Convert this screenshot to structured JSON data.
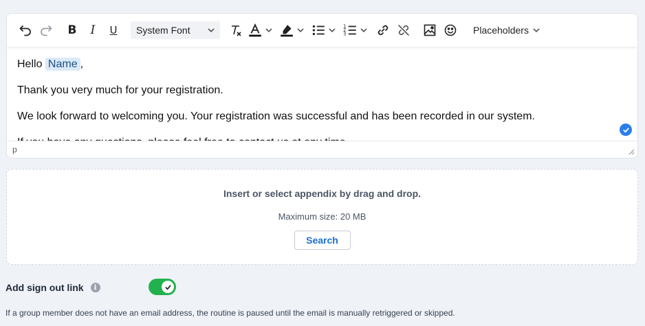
{
  "toolbar": {
    "font_family": "Font",
    "font_family_value": "System Font",
    "placeholders_label": "Placeholders",
    "icons": [
      "undo-icon",
      "redo-icon",
      "bold-icon",
      "italic-icon",
      "underline-icon",
      "clear-format-icon",
      "text-color-icon",
      "highlight-icon",
      "bullet-list-icon",
      "numbered-list-icon",
      "link-icon",
      "unlink-icon",
      "image-icon",
      "emoji-icon"
    ],
    "bold": "B",
    "italic": "I",
    "underline": "U",
    "text_color_accent": "#111111",
    "highlight_accent": "#111111"
  },
  "editor": {
    "greeting_prefix": "Hello",
    "placeholder_tag": "Name",
    "greeting_suffix": ",",
    "line1": "Thank you very much for your registration.",
    "line2": "We look forward to welcoming you. Your registration was successful and has been recorded in our system.",
    "line3": "If you have any questions, please feel free to contact us at any time.",
    "status_path": "p"
  },
  "dropzone": {
    "title": "Insert or select appendix by drag and drop.",
    "max_size": "Maximum size: 20 MB",
    "search_button": "Search"
  },
  "signout": {
    "label": "Add sign out link",
    "info": "i",
    "enabled": true,
    "toggle_color": "#22b14c"
  },
  "note": "If a group member does not have an email address, the routine is paused until the email is manually retriggered or skipped."
}
